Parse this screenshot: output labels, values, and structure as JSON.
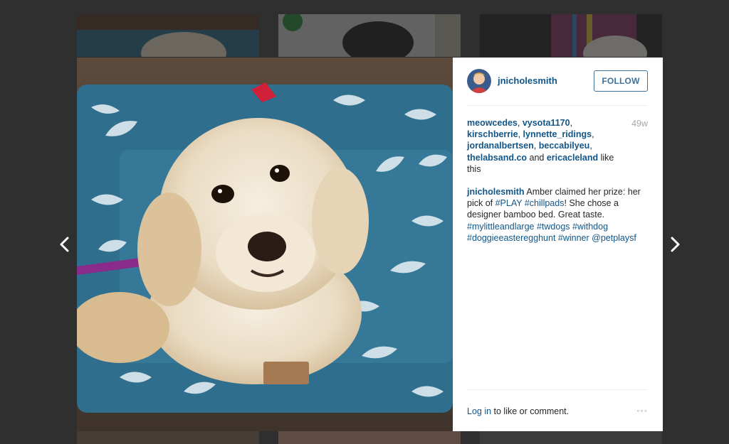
{
  "post": {
    "username": "jnicholesmith",
    "follow_label": "FOLLOW",
    "timestamp": "49w",
    "likes": {
      "users": [
        "meowcedes",
        "vysota1170",
        "kirschberrie",
        "lynnette_ridings",
        "jordanalbertsen",
        "beccabilyeu",
        "thelabsand.co"
      ],
      "and_text": " and ",
      "last_user": "ericacleland",
      "suffix": " like this"
    },
    "caption": {
      "author": "jnicholesmith",
      "text_1": " Amber claimed her prize: her pick of ",
      "tag_play": "#PLAY",
      "space": " ",
      "tag_chillpads": "#chillpads",
      "text_2": "! She chose a designer bamboo bed. Great taste. ",
      "hashtags_line_1": "#mylittleandlarge #twdogs #withdog",
      "hashtags_line_2": "#doggieeasteregghunt #winner @petplaysf"
    },
    "footer": {
      "login_link": "Log in",
      "login_rest": " to like or comment.",
      "more_label": "◦◦◦"
    }
  },
  "nav": {
    "prev_icon": "chevron-left-icon",
    "next_icon": "chevron-right-icon",
    "prev_glyph": "‹",
    "next_glyph": "›"
  },
  "colors": {
    "link": "#125688",
    "follow": "#3f729b",
    "timestamp": "#a5a7aa",
    "overlay": "#4a4a4a"
  }
}
